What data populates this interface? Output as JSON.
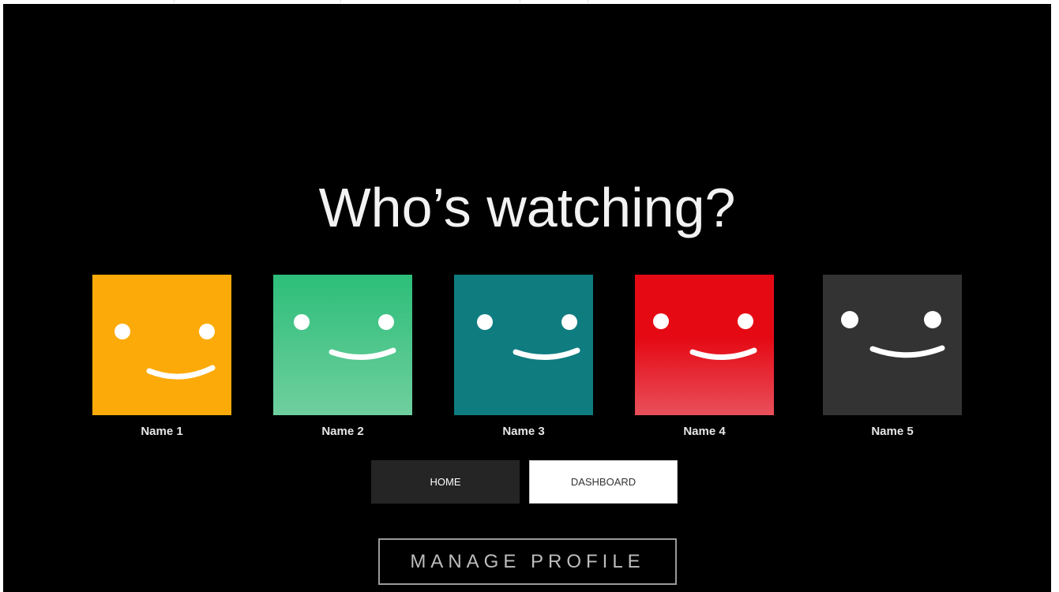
{
  "title": "Who’s watching?",
  "profiles": [
    {
      "name": "Name 1",
      "color": "#FCAA09",
      "color2": "#FCAA09"
    },
    {
      "name": "Name 2",
      "color": "#2DBE7A",
      "color2": "#6FCF9E"
    },
    {
      "name": "Name 3",
      "color": "#0F7C80",
      "color2": "#0F7C80"
    },
    {
      "name": "Name 4",
      "color": "#E50914",
      "color2": "#E8505B"
    },
    {
      "name": "Name 5",
      "color": "#333333",
      "color2": "#333333"
    }
  ],
  "buttons": {
    "home": "HOME",
    "dashboard": "DASHBOARD",
    "manage_profile": "MANAGE PROFILE"
  },
  "colors": {
    "background": "#000000",
    "title": "#F2F2F2"
  }
}
